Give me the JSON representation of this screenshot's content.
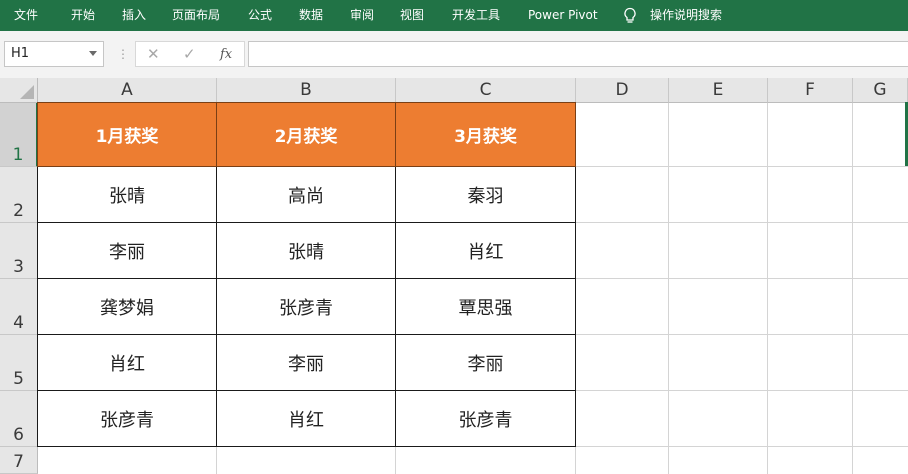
{
  "ribbon": {
    "tabs": [
      "文件",
      "开始",
      "插入",
      "页面布局",
      "公式",
      "数据",
      "审阅",
      "视图",
      "开发工具",
      "Power Pivot"
    ],
    "tell_me": "操作说明搜索"
  },
  "formula_bar": {
    "name_box": "H1",
    "formula": ""
  },
  "grid": {
    "columns": [
      "A",
      "B",
      "C",
      "D",
      "E",
      "F",
      "G"
    ],
    "rows": [
      "1",
      "2",
      "3",
      "4",
      "5",
      "6",
      "7"
    ],
    "selected_row": "1"
  },
  "table": {
    "headers": [
      "1月获奖",
      "2月获奖",
      "3月获奖"
    ],
    "rows": [
      [
        "张晴",
        "高尚",
        "秦羽"
      ],
      [
        "李丽",
        "张晴",
        "肖红"
      ],
      [
        "龚梦娟",
        "张彦青",
        "覃思强"
      ],
      [
        "肖红",
        "李丽",
        "李丽"
      ],
      [
        "张彦青",
        "肖红",
        "张彦青"
      ]
    ]
  },
  "colors": {
    "ribbon_bg": "#217346",
    "header_fill": "#ed7d31",
    "header_text": "#ffffff"
  }
}
